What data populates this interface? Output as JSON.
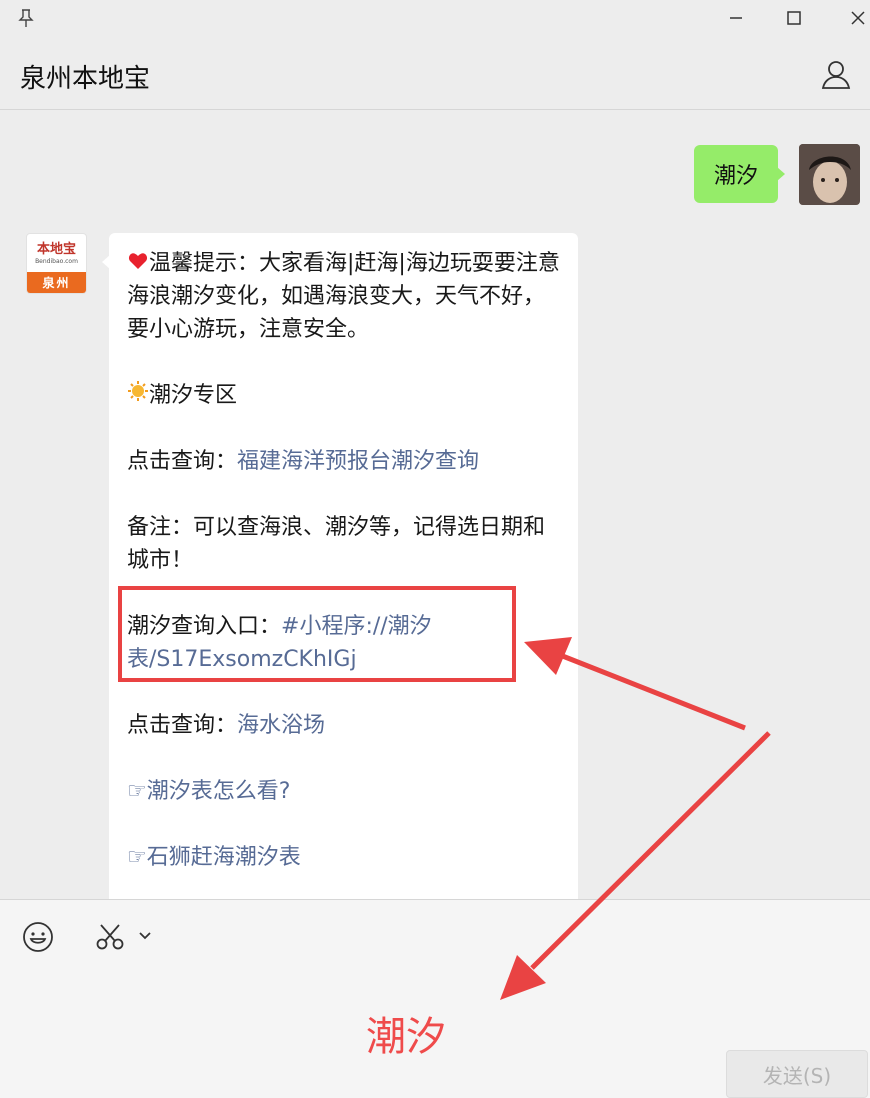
{
  "titlebar": {
    "pin_icon": "pin-icon",
    "minimize_icon": "minimize-icon",
    "maximize_icon": "maximize-icon",
    "close_icon": "close-icon"
  },
  "header": {
    "title": "泉州本地宝",
    "profile_icon": "person-icon"
  },
  "messages": {
    "outgoing": {
      "text": "潮汐"
    },
    "account_avatar": {
      "name": "本地宝",
      "url": "Bendibao.com",
      "city": "泉州"
    },
    "incoming": {
      "p1_text": "温馨提示：大家看海|赶海|海边玩耍要注意海浪潮汐变化，如遇海浪变大，天气不好，要小心游玩，注意安全。",
      "p2_text": "潮汐专区",
      "p3_prefix": "点击查询：",
      "p3_link": "福建海洋预报台潮汐查询",
      "p4_text": "备注：可以查海浪、潮汐等，记得选日期和城市！",
      "p5_prefix": "潮汐查询入口：",
      "p5_link": "#小程序://潮汐表/S17ExsomzCKhIGj",
      "p6_prefix": "点击查询：",
      "p6_link": "海水浴场",
      "p7_link": "☞潮汐表怎么看?",
      "p8_link": "☞石狮赶海潮汐表"
    }
  },
  "input": {
    "emoji_icon": "smiley-icon",
    "scissors_icon": "scissors-icon",
    "text": "潮汐",
    "send_label": "发送(S)"
  },
  "colors": {
    "outgoing_bubble": "#95ec69",
    "link": "#576b95",
    "annotation": "#e94343"
  }
}
